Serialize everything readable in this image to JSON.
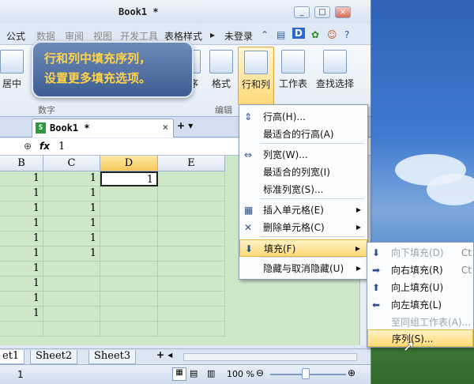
{
  "window": {
    "title": "Book1 *",
    "buttons": [
      "_",
      "□",
      "×"
    ]
  },
  "menubar": {
    "items": [
      "公式",
      "数据",
      "审阅",
      "视图",
      "开发工具",
      "表格样式"
    ],
    "login": "未登录"
  },
  "ribbon": {
    "left_label": "居中",
    "group_labels": {
      "font": "数字",
      "edit": "编辑"
    },
    "buttons": {
      "sort": "排序",
      "format": "格式",
      "rowcol": "行和列",
      "sheet": "工作表",
      "find": "查找选择"
    }
  },
  "callout": {
    "line1": "行和列中填充序列，",
    "line2": "设置更多填充选项。"
  },
  "tab": {
    "doc": "Book1 *"
  },
  "formula": {
    "fx": "fx",
    "value": "1"
  },
  "grid": {
    "columns": [
      "B",
      "C",
      "D",
      "E"
    ],
    "rows": [
      [
        "1",
        "1",
        "1",
        ""
      ],
      [
        "1",
        "1",
        "",
        ""
      ],
      [
        "1",
        "1",
        "",
        ""
      ],
      [
        "1",
        "1",
        "",
        ""
      ],
      [
        "1",
        "1",
        "",
        ""
      ],
      [
        "1",
        "1",
        "",
        ""
      ],
      [
        "1",
        "",
        "",
        ""
      ],
      [
        "1",
        "",
        "",
        ""
      ],
      [
        "1",
        "",
        "",
        ""
      ],
      [
        "1",
        "",
        "",
        ""
      ],
      [
        "",
        "",
        "",
        ""
      ]
    ]
  },
  "sheets": [
    "et1",
    "Sheet2",
    "Sheet3"
  ],
  "status": {
    "left": "1",
    "zoom": "100 %"
  },
  "menu": {
    "items": [
      {
        "icon": "row-height-icon",
        "label": "行高(H)..."
      },
      {
        "icon": "",
        "label": "最适合的行高(A)"
      },
      {
        "icon": "col-width-icon",
        "label": "列宽(W)..."
      },
      {
        "icon": "",
        "label": "最适合的列宽(I)"
      },
      {
        "icon": "",
        "label": "标准列宽(S)..."
      },
      {
        "icon": "insert-cell-icon",
        "label": "插入单元格(E)"
      },
      {
        "icon": "delete-cell-icon",
        "label": "删除单元格(C)"
      },
      {
        "icon": "fill-icon",
        "label": "填充(F)"
      },
      {
        "icon": "",
        "label": "隐藏与取消隐藏(U)"
      }
    ]
  },
  "submenu": {
    "items": [
      {
        "label": "向下填充(D)",
        "shortcut": "Ct",
        "disabled": true
      },
      {
        "label": "向右填充(R)",
        "shortcut": "Ct",
        "disabled": false
      },
      {
        "label": "向上填充(U)",
        "shortcut": "",
        "disabled": false
      },
      {
        "label": "向左填充(L)",
        "shortcut": "",
        "disabled": false
      },
      {
        "label": "至同组工作表(A)...",
        "shortcut": "",
        "disabled": true
      },
      {
        "label": "序列(S)...",
        "shortcut": "",
        "disabled": false
      }
    ]
  },
  "colors": {
    "grid_bg": "#cfe7c9",
    "callout_text": "#ffd34a",
    "highlight": "#ffd978"
  }
}
